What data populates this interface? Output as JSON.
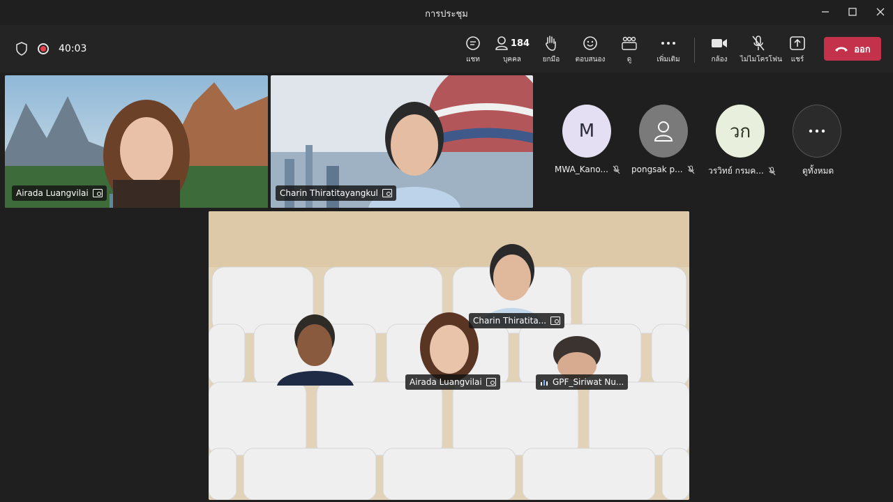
{
  "window": {
    "title": "การประชุม"
  },
  "toolbar": {
    "timer": "40:03",
    "chat_label": "แชท",
    "people_label": "บุคคล",
    "people_count": "184",
    "raise_label": "ยกมือ",
    "react_label": "ตอบสนอง",
    "view_label": "ดู",
    "more_label": "เพิ่มเติม",
    "camera_label": "กล้อง",
    "mic_label": "ไม่ไมโครโฟน",
    "share_label": "แชร์",
    "leave_label": "ออก"
  },
  "video_tiles": [
    {
      "name": "Airada Luangvilai"
    },
    {
      "name": "Charin Thiratitayangkul"
    }
  ],
  "avatars": [
    {
      "initials": "M",
      "name": "MWA_Kano..."
    },
    {
      "initials": "",
      "name": "pongsak p..."
    },
    {
      "initials": "วก",
      "name": "วรวิทย์ กรมค..."
    },
    {
      "initials": "",
      "name": "ดูทั้งหมด"
    }
  ],
  "together_mode": {
    "names": [
      "Charin Thiratita...",
      "Airada Luangvilai",
      "GPF_Siriwat Nu..."
    ]
  },
  "colors": {
    "leave": "#c4314b",
    "recording": "#e8414b",
    "background": "#1f1f1f"
  }
}
